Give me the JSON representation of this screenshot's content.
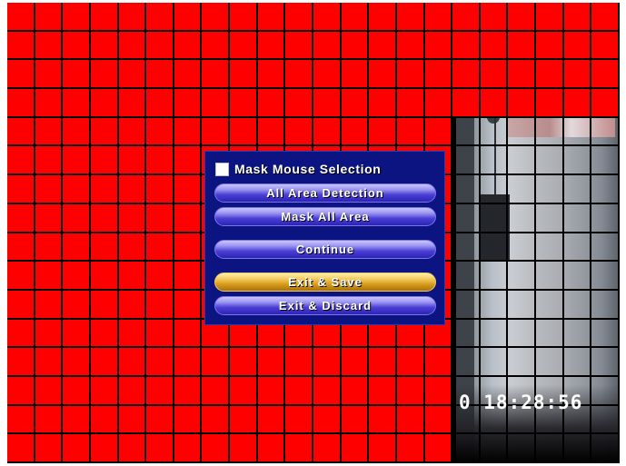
{
  "screen": {
    "grid": {
      "columns": 22,
      "rows": 16
    },
    "unmasked_region": {
      "col_from": 16,
      "col_to": 21,
      "row_from": 4,
      "row_to": 15
    },
    "mask_color": "#ff0000",
    "timestamp": "0 18:28:56"
  },
  "dialog": {
    "checkbox_label": "Mask Mouse Selection",
    "checkbox_checked": false,
    "buttons": [
      {
        "label": "All Area Detection",
        "style": "blue"
      },
      {
        "label": "Mask All Area",
        "style": "blue"
      },
      {
        "label": "Continue",
        "style": "blue"
      },
      {
        "label": "Exit & Save",
        "style": "gold"
      },
      {
        "label": "Exit & Discard",
        "style": "blue"
      }
    ]
  }
}
